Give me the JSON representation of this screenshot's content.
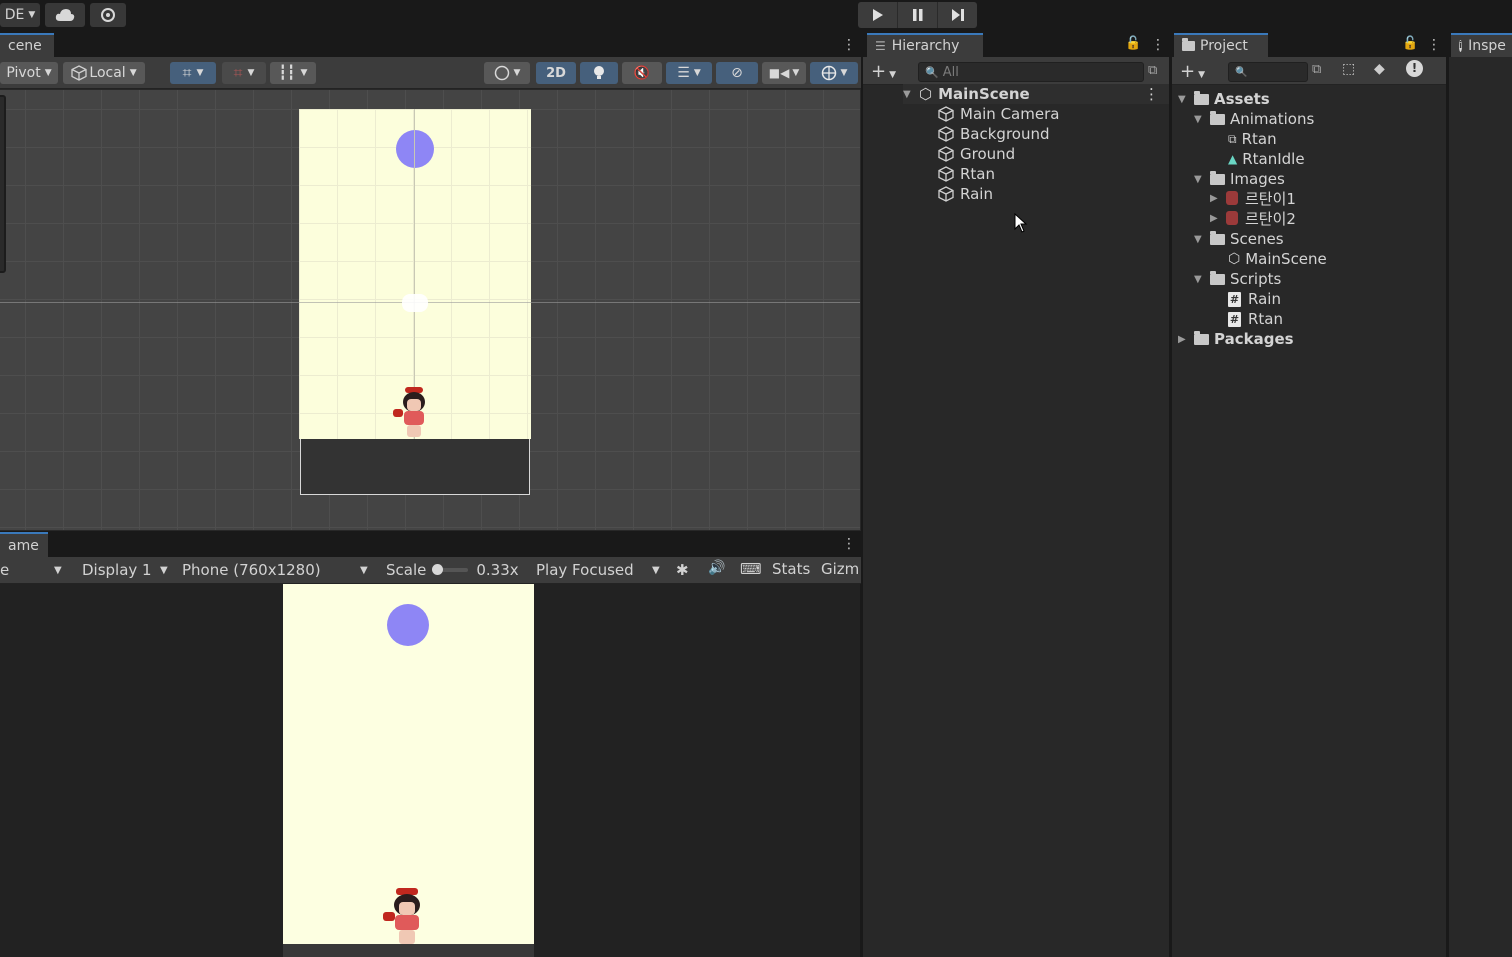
{
  "topbar": {
    "account_label": "DE",
    "play_controls": [
      "play",
      "pause",
      "step"
    ]
  },
  "scene_panel": {
    "tab_label": "cene",
    "pivot_label": "Pivot",
    "local_label": "Local",
    "mode_2d_label": "2D"
  },
  "game_panel": {
    "tab_label": "ame",
    "display_label": "Display 1",
    "resolution_label": "Phone (760x1280)",
    "scale_label": "Scale",
    "scale_value": "0.33x",
    "play_mode_label": "Play Focused",
    "stats_label": "Stats",
    "gizmos_label": "Gizm",
    "left_dropdown_label": "e"
  },
  "hierarchy": {
    "tab_label": "Hierarchy",
    "search_placeholder": "All",
    "scene_name": "MainScene",
    "objects": [
      "Main Camera",
      "Background",
      "Ground",
      "Rtan",
      "Rain"
    ]
  },
  "project": {
    "tab_label": "Project",
    "tree": {
      "assets": "Assets",
      "animations": "Animations",
      "anim_rtan": "Rtan",
      "anim_idle": "RtanIdle",
      "images": "Images",
      "image_1": "르탄이1",
      "image_2": "르탄이2",
      "scenes": "Scenes",
      "scene_main": "MainScene",
      "scripts": "Scripts",
      "script_rain": "Rain",
      "script_rtan": "Rtan",
      "packages": "Packages"
    }
  },
  "inspector": {
    "tab_label": "Inspe"
  },
  "colors": {
    "accent_blue": "#3a79bb",
    "rain_circle": "#8e86f5",
    "background_yellow": "#fcfedc"
  }
}
